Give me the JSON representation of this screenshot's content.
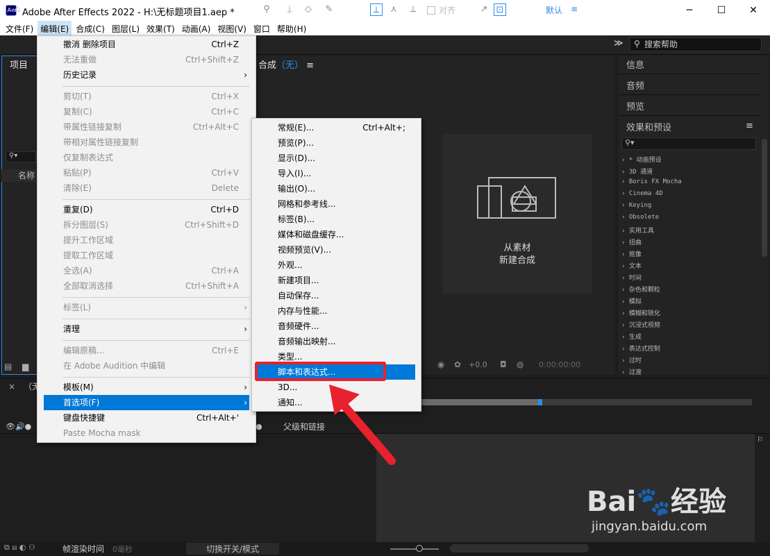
{
  "window": {
    "title": "Adobe After Effects 2022 - H:\\无标题项目1.aep *",
    "icon": "Ae",
    "controls": {
      "minimize": "─",
      "maximize": "☐",
      "close": "✕"
    }
  },
  "menubar": [
    "文件(F)",
    "编辑(E)",
    "合成(C)",
    "图层(L)",
    "效果(T)",
    "动画(A)",
    "视图(V)",
    "窗口",
    "帮助(H)"
  ],
  "toolbar": {
    "align_label": "对齐",
    "workspace": "默认",
    "more": "≫",
    "help_placeholder": "搜索帮助"
  },
  "project_panel": {
    "title": "项目",
    "search": "",
    "name_col": "名称"
  },
  "comp_panel": {
    "title": "合成（无）",
    "empty_l1": "从素材",
    "empty_l2": "新建合成"
  },
  "right_panel": {
    "info": "信息",
    "audio": "音频",
    "preview": "预览",
    "effects": "效果和预设",
    "effects_items": [
      "* 动画预设",
      "3D 通道",
      "Boris FX Mocha",
      "Cinema 4D",
      "Keying",
      "Obsolete",
      "实用工具",
      "扭曲",
      "抠像",
      "文本",
      "时间",
      "杂色和颗粒",
      "模拟",
      "模糊和锐化",
      "沉浸式视频",
      "生成",
      "表达式控制",
      "过时",
      "过渡"
    ]
  },
  "comp_footer": {
    "fps": "+0.0",
    "time": "0:00:00:00"
  },
  "timeline": {
    "tab": "（无",
    "parent_label": "父级和链接",
    "render_label": "帧渲染时间",
    "render_value": "0毫秒",
    "toggle_label": "切换开关/模式"
  },
  "edit_menu": [
    {
      "label": "撤消 删除项目",
      "shortcut": "Ctrl+Z",
      "disabled": false
    },
    {
      "label": "无法重做",
      "shortcut": "Ctrl+Shift+Z",
      "disabled": true
    },
    {
      "label": "历史记录",
      "shortcut": "",
      "disabled": false,
      "submenu": true
    },
    {
      "sep": true
    },
    {
      "label": "剪切(T)",
      "shortcut": "Ctrl+X",
      "disabled": true
    },
    {
      "label": "复制(C)",
      "shortcut": "Ctrl+C",
      "disabled": true
    },
    {
      "label": "带属性链接复制",
      "shortcut": "Ctrl+Alt+C",
      "disabled": true
    },
    {
      "label": "带相对属性链接复制",
      "shortcut": "",
      "disabled": true
    },
    {
      "label": "仅复制表达式",
      "shortcut": "",
      "disabled": true
    },
    {
      "label": "粘贴(P)",
      "shortcut": "Ctrl+V",
      "disabled": true
    },
    {
      "label": "清除(E)",
      "shortcut": "Delete",
      "disabled": true
    },
    {
      "sep": true
    },
    {
      "label": "重复(D)",
      "shortcut": "Ctrl+D",
      "disabled": false
    },
    {
      "label": "拆分图层(S)",
      "shortcut": "Ctrl+Shift+D",
      "disabled": true
    },
    {
      "label": "提升工作区域",
      "shortcut": "",
      "disabled": true
    },
    {
      "label": "提取工作区域",
      "shortcut": "",
      "disabled": true
    },
    {
      "label": "全选(A)",
      "shortcut": "Ctrl+A",
      "disabled": true
    },
    {
      "label": "全部取消选择",
      "shortcut": "Ctrl+Shift+A",
      "disabled": true
    },
    {
      "sep": true
    },
    {
      "label": "标签(L)",
      "shortcut": "",
      "disabled": true,
      "submenu": true
    },
    {
      "sep": true
    },
    {
      "label": "清理",
      "shortcut": "",
      "disabled": false,
      "submenu": true
    },
    {
      "sep": true
    },
    {
      "label": "编辑原稿...",
      "shortcut": "Ctrl+E",
      "disabled": true
    },
    {
      "label": "在 Adobe Audition 中编辑",
      "shortcut": "",
      "disabled": true
    },
    {
      "sep": true
    },
    {
      "label": "模板(M)",
      "shortcut": "",
      "disabled": false,
      "submenu": true
    },
    {
      "label": "首选项(F)",
      "shortcut": "",
      "disabled": false,
      "submenu": true,
      "highlight": true
    },
    {
      "label": "键盘快捷键",
      "shortcut": "Ctrl+Alt+'",
      "disabled": false
    },
    {
      "label": "Paste Mocha mask",
      "shortcut": "",
      "disabled": true
    }
  ],
  "prefs_menu": [
    {
      "label": "常规(E)...",
      "shortcut": "Ctrl+Alt+;"
    },
    {
      "label": "预览(P)..."
    },
    {
      "label": "显示(D)..."
    },
    {
      "label": "导入(I)..."
    },
    {
      "label": "输出(O)..."
    },
    {
      "label": "网格和参考线..."
    },
    {
      "label": "标签(B)..."
    },
    {
      "label": "媒体和磁盘缓存..."
    },
    {
      "label": "视频预览(V)..."
    },
    {
      "label": "外观..."
    },
    {
      "label": "新建项目..."
    },
    {
      "label": "自动保存..."
    },
    {
      "label": "内存与性能..."
    },
    {
      "label": "音频硬件..."
    },
    {
      "label": "音频输出映射..."
    },
    {
      "label": "类型..."
    },
    {
      "label": "脚本和表达式...",
      "highlight": true
    },
    {
      "label": "3D..."
    },
    {
      "label": "通知..."
    }
  ],
  "watermark": {
    "logo": "Bai🐾经验",
    "url": "jingyan.baidu.com"
  },
  "colors": {
    "highlight": "#0078d7",
    "annotation": "#e8212e",
    "accent": "#2d8ceb"
  }
}
